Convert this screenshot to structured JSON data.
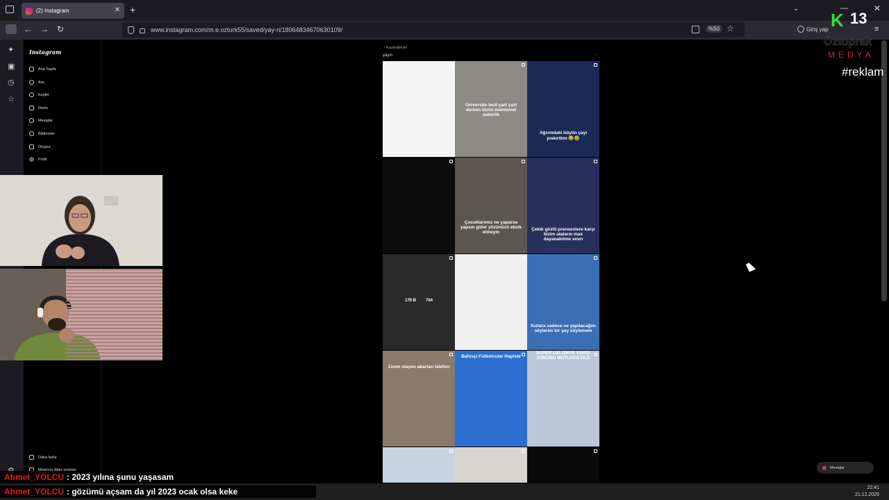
{
  "browser": {
    "tab_title": "(2) Instagram",
    "tab_close": "✕",
    "new_tab": "+",
    "url": "www.instagram.com/m.e.ozturk55/saved/yay-n/18064834670630109/",
    "zoom": "%50",
    "login_label": "Giriş yap",
    "back": "←",
    "forward": "→",
    "reload": "↻",
    "star": "☆",
    "menu": "≡",
    "dropdown": "⌄",
    "minimize": "—",
    "close": "✕"
  },
  "instagram": {
    "logo": "Instagram",
    "nav": [
      {
        "label": "Ana Sayfa",
        "icon": "home-icon"
      },
      {
        "label": "Ara",
        "icon": "search-icon"
      },
      {
        "label": "Keşfet",
        "icon": "compass-icon"
      },
      {
        "label": "Reels",
        "icon": "reels-icon"
      },
      {
        "label": "Mesajlar",
        "icon": "messenger-icon"
      },
      {
        "label": "Bildirimler",
        "icon": "heart-icon"
      },
      {
        "label": "Oluştur",
        "icon": "plus-icon"
      },
      {
        "label": "Profil",
        "icon": "profile-icon"
      }
    ],
    "more_label": "Daha fazla",
    "meta_label": "Meta'nın diğer ürünleri",
    "breadcrumb": "‹ Kaydedilenler",
    "collection_title": "yayın",
    "more_dots": "...",
    "posts": [
      {
        "caption": "",
        "bg": "#f4f4f4"
      },
      {
        "caption": "Üniversite tecil çart çurt derken bizim müntemel askerlik",
        "bg": "#8c8a85"
      },
      {
        "caption": "Ağzımdaki büyün çayı pıskırttım 😂🤣",
        "bg": "#1b2a55"
      },
      {
        "caption": "",
        "bg": "#0c0c0c"
      },
      {
        "caption": "Çocuklarımız ne yaparsa yapsın güler yüzünüzü eksik etmeyin",
        "bg": "#5b5650"
      },
      {
        "caption": "Çekik gözlü prenseslere karşı bizim ataların max dayanabilme sınırı",
        "bg": "#27305a"
      },
      {
        "caption": "",
        "bg": "#2a2a2a"
      },
      {
        "caption": "",
        "bg": "#efefef"
      },
      {
        "caption": "Kızlara sadece ne yapılacağını söylerim bir şey söylemem",
        "bg": "#3a6fb5"
      },
      {
        "caption": "Zoom olayını abartan telefon",
        "bg": "#8a7a6a"
      },
      {
        "caption": "Bahisçi Futbolcular Hapiste",
        "bg": "#2d6fd1"
      },
      {
        "caption": "SÜPER LİG ZİRVE YARIŞI SONUNU MUTLAKA İZLE",
        "bg": "#b9c7d8"
      },
      {
        "caption": "",
        "bg": "#c7d3e0"
      },
      {
        "caption": "",
        "bg": "#d8d4cf"
      },
      {
        "caption": "",
        "bg": "#0a0a0a"
      }
    ],
    "like_count": "179 B",
    "comment_count": "704",
    "messages_button": "Mesajlar"
  },
  "stream": {
    "brand_letter": "K",
    "brand_number": "13",
    "brand_name": "Öztoprak",
    "brand_media": "MEDYA",
    "hashtag": "#reklam",
    "chat": [
      {
        "user": "Ahmet_YOLCU",
        "message": ": 2023 yılına şunu yaşasam"
      },
      {
        "user": "Ahmet_YOLCU",
        "message": ": gözümü açsam da yıl 2023 ocak olsa keke"
      }
    ]
  },
  "taskbar": {
    "time": "22:41",
    "date": "21.12.2025"
  }
}
